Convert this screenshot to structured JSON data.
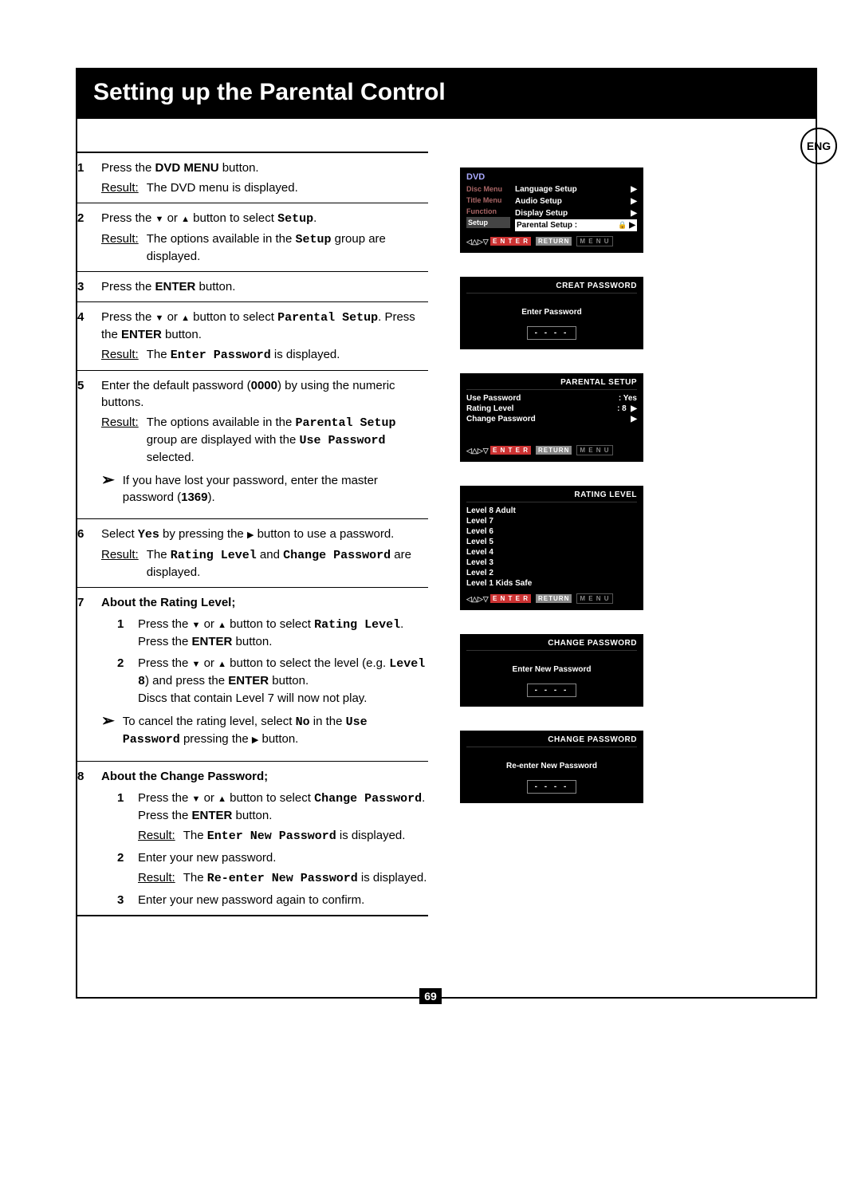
{
  "page": {
    "title": "Setting up the Parental Control",
    "lang_badge": "ENG",
    "number": "69"
  },
  "steps": {
    "s1": {
      "num": "1",
      "line1a": "Press the ",
      "line1b": "DVD MENU",
      "line1c": " button.",
      "result": "The DVD menu is displayed.",
      "result_label": "Result:"
    },
    "s2": {
      "num": "2",
      "line1a": "Press the ",
      "line1b": " or ",
      "line1c": " button to select ",
      "line1d": "Setup",
      "line1e": ".",
      "result_label": "Result:",
      "result_a": "The options available in the ",
      "result_b": "Setup",
      "result_c": " group are displayed."
    },
    "s3": {
      "num": "3",
      "line1a": "Press the ",
      "line1b": "ENTER",
      "line1c": " button."
    },
    "s4": {
      "num": "4",
      "line1a": "Press the ",
      "line1b": " or ",
      "line1c": " button to select ",
      "line1d": "Parental Setup",
      "line1e": ". Press the ",
      "line1f": "ENTER",
      "line1g": " button.",
      "result_label": "Result:",
      "result_a": "The ",
      "result_b": "Enter Password",
      "result_c": " is displayed."
    },
    "s5": {
      "num": "5",
      "line1a": "Enter the default password (",
      "line1b": "0000",
      "line1c": ") by using the numeric buttons.",
      "result_label": "Result:",
      "result_a": "The options available in the ",
      "result_b": "Parental Setup",
      "result_c": " group are displayed with the ",
      "result_d": "Use Password",
      "result_e": " selected.",
      "note_a": "If you have lost your password, enter the master password (",
      "note_b": "1369",
      "note_c": ")."
    },
    "s6": {
      "num": "6",
      "line1a": "Select ",
      "line1b": "Yes",
      "line1c": " by pressing the ",
      "line1d": " button to use a password.",
      "result_label": "Result:",
      "result_a": "The ",
      "result_b": "Rating Level",
      "result_c": " and ",
      "result_d": "Change Password",
      "result_e": " are displayed."
    },
    "s7": {
      "num": "7",
      "title": "About the Rating Level;",
      "sub1": {
        "num": "1",
        "a": "Press the ",
        "b": " or ",
        "c": " button to select ",
        "d": "Rating Level",
        "e": ". Press the ",
        "f": "ENTER",
        "g": " button."
      },
      "sub2": {
        "num": "2",
        "a": "Press the ",
        "b": " or ",
        "c": " button to select the level (e.g. ",
        "d": "Level 8",
        "e": ") and press the ",
        "f": "ENTER",
        "g": " button.",
        "h": "Discs that contain Level 7 will now not play."
      },
      "note_a": "To cancel the rating level, select ",
      "note_b": "No",
      "note_c": " in the ",
      "note_d": "Use Password",
      "note_e": " pressing the ",
      "note_f": " button."
    },
    "s8": {
      "num": "8",
      "title": "About the Change Password;",
      "sub1": {
        "num": "1",
        "a": "Press the ",
        "b": " or ",
        "c": " button to select ",
        "d": "Change Password",
        "e": ". Press the ",
        "f": "ENTER",
        "g": " button.",
        "result_label": "Result:",
        "ra": "The ",
        "rb": "Enter New Password",
        "rc": " is displayed."
      },
      "sub2": {
        "num": "2",
        "a": "Enter your new password.",
        "result_label": "Result:",
        "ra": "The ",
        "rb": "Re-enter New Password",
        "rc": " is displayed."
      },
      "sub3": {
        "num": "3",
        "a": "Enter your new password again to confirm."
      }
    }
  },
  "osd1": {
    "dvd": "DVD",
    "side": [
      "Disc Menu",
      "Title Menu",
      "Function",
      "Setup"
    ],
    "items": [
      {
        "label": "Language Setup",
        "sel": false
      },
      {
        "label": "Audio Setup",
        "sel": false
      },
      {
        "label": "Display Setup",
        "sel": false
      },
      {
        "label": "Parental Setup :",
        "sel": true,
        "lock": true
      }
    ],
    "foot": {
      "enter": "E N T E R",
      "return": "RETURN",
      "menu": "M E N U"
    }
  },
  "osd2": {
    "hdr": "CREAT PASSWORD",
    "label": "Enter Password",
    "dashes": "- - - -"
  },
  "osd3": {
    "hdr": "PARENTAL SETUP",
    "rows": [
      {
        "l": "Use Password",
        "r": ": Yes",
        "arrow": false
      },
      {
        "l": "Rating Level",
        "r": ": 8",
        "arrow": true
      },
      {
        "l": "Change Password",
        "r": "",
        "arrow": true
      }
    ],
    "foot": {
      "enter": "E N T E R",
      "return": "RETURN",
      "menu": "M E N U"
    }
  },
  "osd4": {
    "hdr": "RATING LEVEL",
    "levels": [
      "Level 8  Adult",
      "Level 7",
      "Level 6",
      "Level 5",
      "Level 4",
      "Level 3",
      "Level 2",
      "Level 1  Kids Safe"
    ],
    "foot": {
      "enter": "E N T E R",
      "return": "RETURN",
      "menu": "M E N U"
    }
  },
  "osd5": {
    "hdr": "CHANGE PASSWORD",
    "label": "Enter New Password",
    "dashes": "- - - -"
  },
  "osd6": {
    "hdr": "CHANGE PASSWORD",
    "label": "Re-enter New Password",
    "dashes": "- - - -"
  }
}
